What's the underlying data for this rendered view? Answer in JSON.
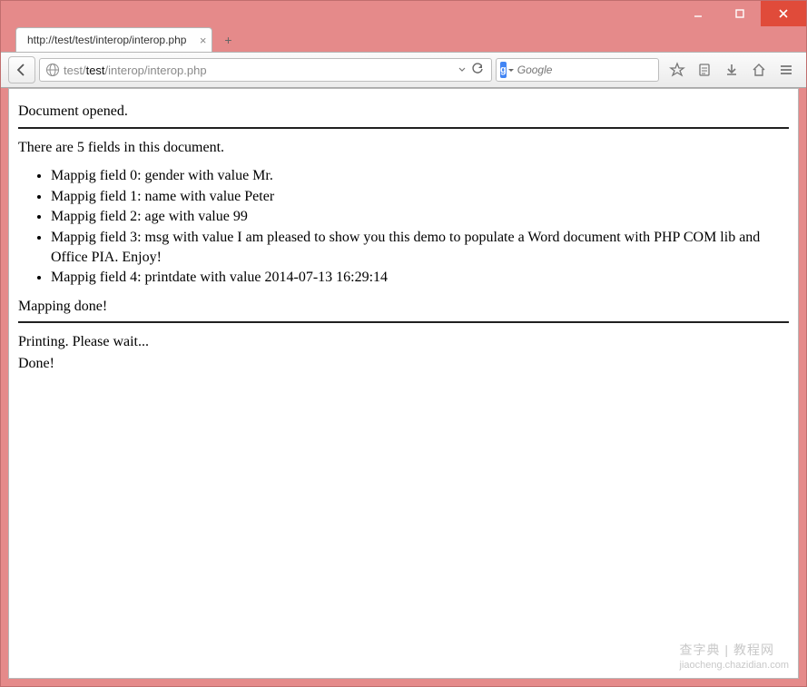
{
  "window": {
    "tab_title": "http://test/test/interop/interop.php"
  },
  "nav": {
    "url_gray_prefix": "test/",
    "url_black": "test",
    "url_gray_suffix": "/interop/interop.php",
    "search_provider_badge": "g",
    "search_placeholder": "Google"
  },
  "page": {
    "doc_opened": "Document opened.",
    "fields_intro": "There are 5 fields in this document.",
    "fields": [
      "Mappig field 0: gender with value Mr.",
      "Mappig field 1: name with value Peter",
      "Mappig field 2: age with value 99",
      "Mappig field 3: msg with value I am pleased to show you this demo to populate a Word document with PHP COM lib and Office PIA. Enjoy!",
      "Mappig field 4: printdate with value 2014-07-13 16:29:14"
    ],
    "mapping_done": "Mapping done!",
    "printing": "Printing. Please wait...",
    "done": "Done!"
  },
  "watermark": {
    "line1": "查字典 | 教程网",
    "line2": "jiaocheng.chazidian.com"
  }
}
